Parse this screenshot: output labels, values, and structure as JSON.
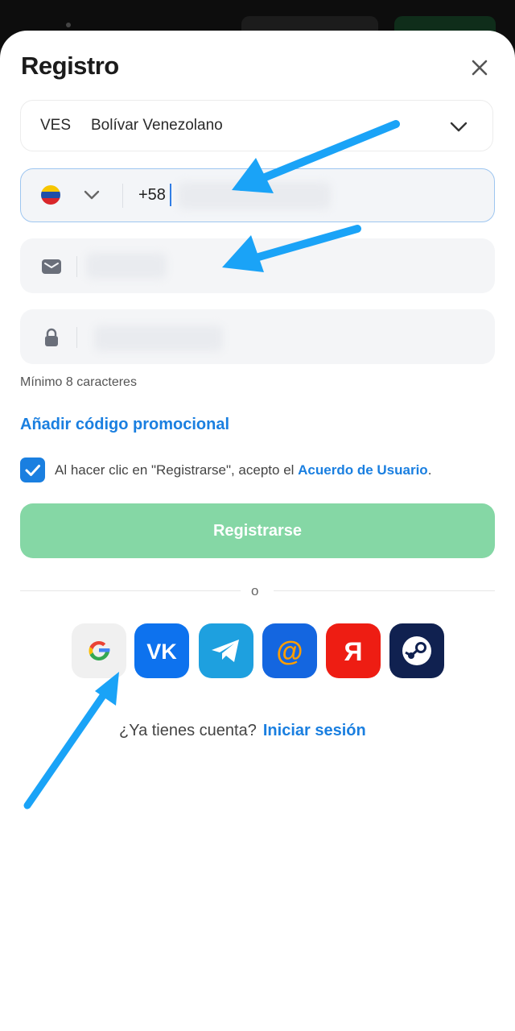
{
  "modal": {
    "title": "Registro"
  },
  "currency": {
    "code": "VES",
    "name": "Bolívar Venezolano"
  },
  "phone": {
    "country": "Venezuela",
    "prefix": "+58"
  },
  "password": {
    "hint": "Mínimo 8 caracteres"
  },
  "promo": {
    "label": "Añadir código promocional"
  },
  "agreement": {
    "checked": true,
    "text": "Al hacer clic en \"Registrarse\", acepto el ",
    "link": "Acuerdo de Usuario",
    "suffix": "."
  },
  "register_button": {
    "label": "Registrarse"
  },
  "divider": {
    "text": "o"
  },
  "social": [
    "google-icon",
    "vk-icon",
    "telegram-icon",
    "mail-ru-icon",
    "yandex-icon",
    "steam-icon"
  ],
  "login_prompt": {
    "question": "¿Ya tienes cuenta?",
    "link": "Iniciar sesión"
  },
  "colors": {
    "accent": "#1a7fe0",
    "register_button": "#85d7a5",
    "annotation_arrow": "#1aa3f7"
  }
}
